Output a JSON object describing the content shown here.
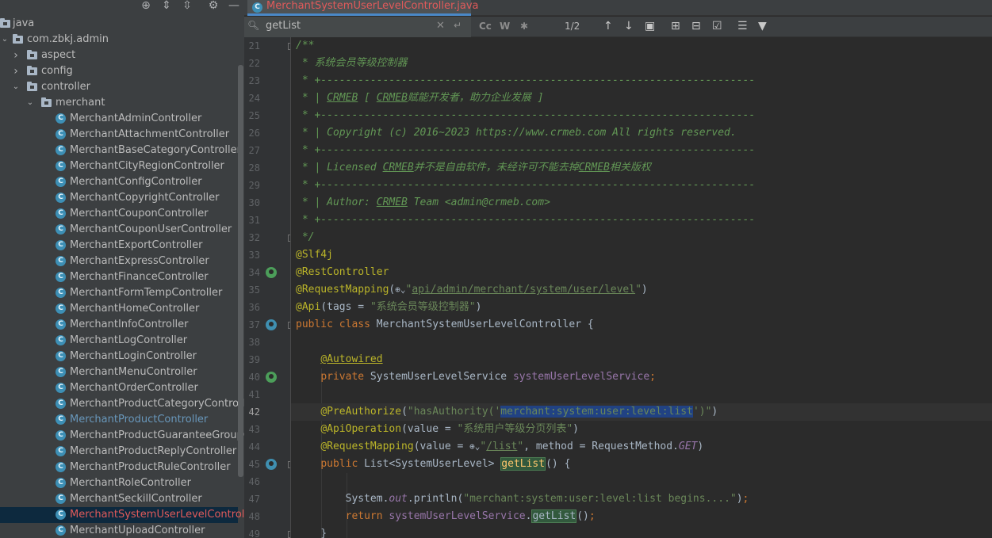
{
  "project": {
    "toolbar_icons": [
      "target-icon",
      "expand-all-icon",
      "collapse-all-icon",
      "gear-icon",
      "minimize-icon"
    ],
    "tree": [
      {
        "label": "java",
        "depth": 0,
        "kind": "folder",
        "arrow": "none"
      },
      {
        "label": "com.zbkj.admin",
        "depth": 0,
        "kind": "folder",
        "arrow": "down"
      },
      {
        "label": "aspect",
        "depth": 1,
        "kind": "folder",
        "arrow": "right"
      },
      {
        "label": "config",
        "depth": 1,
        "kind": "folder",
        "arrow": "right"
      },
      {
        "label": "controller",
        "depth": 1,
        "kind": "folder",
        "arrow": "down"
      },
      {
        "label": "merchant",
        "depth": 2,
        "kind": "folder",
        "arrow": "down"
      },
      {
        "label": "MerchantAdminController",
        "depth": 3,
        "kind": "class"
      },
      {
        "label": "MerchantAttachmentController",
        "depth": 3,
        "kind": "class"
      },
      {
        "label": "MerchantBaseCategoryController",
        "depth": 3,
        "kind": "class"
      },
      {
        "label": "MerchantCityRegionController",
        "depth": 3,
        "kind": "class"
      },
      {
        "label": "MerchantConfigController",
        "depth": 3,
        "kind": "class"
      },
      {
        "label": "MerchantCopyrightController",
        "depth": 3,
        "kind": "class"
      },
      {
        "label": "MerchantCouponController",
        "depth": 3,
        "kind": "class"
      },
      {
        "label": "MerchantCouponUserController",
        "depth": 3,
        "kind": "class"
      },
      {
        "label": "MerchantExportController",
        "depth": 3,
        "kind": "class"
      },
      {
        "label": "MerchantExpressController",
        "depth": 3,
        "kind": "class"
      },
      {
        "label": "MerchantFinanceController",
        "depth": 3,
        "kind": "class"
      },
      {
        "label": "MerchantFormTempController",
        "depth": 3,
        "kind": "class"
      },
      {
        "label": "MerchantHomeController",
        "depth": 3,
        "kind": "class"
      },
      {
        "label": "MerchantInfoController",
        "depth": 3,
        "kind": "class"
      },
      {
        "label": "MerchantLogController",
        "depth": 3,
        "kind": "class"
      },
      {
        "label": "MerchantLoginController",
        "depth": 3,
        "kind": "class"
      },
      {
        "label": "MerchantMenuController",
        "depth": 3,
        "kind": "class"
      },
      {
        "label": "MerchantOrderController",
        "depth": 3,
        "kind": "class"
      },
      {
        "label": "MerchantProductCategoryController",
        "depth": 3,
        "kind": "class"
      },
      {
        "label": "MerchantProductController",
        "depth": 3,
        "kind": "class",
        "state": "changed"
      },
      {
        "label": "MerchantProductGuaranteeGroupController",
        "depth": 3,
        "kind": "class"
      },
      {
        "label": "MerchantProductReplyController",
        "depth": 3,
        "kind": "class"
      },
      {
        "label": "MerchantProductRuleController",
        "depth": 3,
        "kind": "class"
      },
      {
        "label": "MerchantRoleController",
        "depth": 3,
        "kind": "class"
      },
      {
        "label": "MerchantSeckillController",
        "depth": 3,
        "kind": "class"
      },
      {
        "label": "MerchantSystemUserLevelController",
        "depth": 3,
        "kind": "class",
        "state": "selected"
      },
      {
        "label": "MerchantUploadController",
        "depth": 3,
        "kind": "class"
      }
    ]
  },
  "editor": {
    "tab": {
      "label": "MerchantSystemUserLevelController.java",
      "icon": "class-icon"
    },
    "search": {
      "query": "getList",
      "match_count": "1/2",
      "options": [
        "Cc",
        "W"
      ]
    },
    "current_line": "42",
    "lines": [
      {
        "n": "21",
        "html": "<span class='cmt'>/**</span>"
      },
      {
        "n": "22",
        "html": "<span class='cmt'> * 系统会员等级控制器</span>"
      },
      {
        "n": "23",
        "html": "<span class='cmt'> * +----------------------------------------------------------------------</span>"
      },
      {
        "n": "24",
        "html": "<span class='cmt'> * | <u>CRMEB</u> [ <u>CRMEB</u>赋能开发者，助力企业发展 ]</span>"
      },
      {
        "n": "25",
        "html": "<span class='cmt'> * +----------------------------------------------------------------------</span>"
      },
      {
        "n": "26",
        "html": "<span class='cmt'> * | Copyright (c) 2016~2023 https://www.crmeb.com All rights reserved.</span>"
      },
      {
        "n": "27",
        "html": "<span class='cmt'> * +----------------------------------------------------------------------</span>"
      },
      {
        "n": "28",
        "html": "<span class='cmt'> * | Licensed <u>CRMEB</u>并不是自由软件，未经许可不能去掉<u>CRMEB</u>相关版权</span>"
      },
      {
        "n": "29",
        "html": "<span class='cmt'> * +----------------------------------------------------------------------</span>"
      },
      {
        "n": "30",
        "html": "<span class='cmt'> * | Author: <u>CRMEB</u> Team &lt;admin@crmeb.com&gt;</span>"
      },
      {
        "n": "31",
        "html": "<span class='cmt'> * +----------------------------------------------------------------------</span>"
      },
      {
        "n": "32",
        "html": "<span class='cmt'> */</span>"
      },
      {
        "n": "33",
        "html": "<span class='ann'>@Slf4j</span>"
      },
      {
        "n": "34",
        "html": "<span class='ann'>@RestController</span>",
        "gutter": "green"
      },
      {
        "n": "35",
        "html": "<span class='ann'>@RequestMapping</span>(<span class='globe'>⊕⌄</span><span class='str'>\"<span class='uri'>api/admin/merchant/system/user/level</span>\"</span>)"
      },
      {
        "n": "36",
        "html": "<span class='ann'>@Api</span>(tags = <span class='str'>\"系统会员等级控制器\"</span>)"
      },
      {
        "n": "37",
        "html": "<span class='kw'>public class</span> MerchantSystemUserLevelController {",
        "gutter": "blue"
      },
      {
        "n": "38",
        "html": ""
      },
      {
        "n": "39",
        "html": "    <span class='ann'><u>@Autowired</u></span>"
      },
      {
        "n": "40",
        "html": "    <span class='kw'>private</span> SystemUserLevelService <span class='fld'>systemUserLevelService</span><span class='kw'>;</span>",
        "gutter": "green"
      },
      {
        "n": "41",
        "html": ""
      },
      {
        "n": "42",
        "html": "    <span class='ann'>@PreAuthorize</span>(<span class='str'>\"hasAuthority('<span class='sel'>merchant:system:user:level:list</span>')\"</span>)",
        "current": true
      },
      {
        "n": "43",
        "html": "    <span class='ann'>@ApiOperation</span>(value = <span class='str'>\"系统用户等级分页列表\"</span>)"
      },
      {
        "n": "44",
        "html": "    <span class='ann'>@RequestMapping</span>(value = <span class='globe'>⊕⌄</span><span class='str'>\"<span class='uri'>/list</span>\"</span>, method = RequestMethod.<span class='it'>GET</span>)"
      },
      {
        "n": "45",
        "html": "    <span class='kw'>public</span> List&lt;SystemUserLevel&gt; <span class='method-hl'>getList</span>() {",
        "gutter": "blue"
      },
      {
        "n": "46",
        "html": ""
      },
      {
        "n": "47",
        "html": "        System.<span class='it'>out</span>.println(<span class='str'>\"merchant:system:user:level:list begins....\"</span>)<span class='kw'>;</span>"
      },
      {
        "n": "48",
        "html": "        <span class='kw'>return</span> <span class='fld'>systemUserLevelService</span>.<span class='method-hl' style='color:#a9b7c6'>getList</span>()<span class='kw'>;</span>"
      },
      {
        "n": "49",
        "html": "    }"
      }
    ]
  }
}
